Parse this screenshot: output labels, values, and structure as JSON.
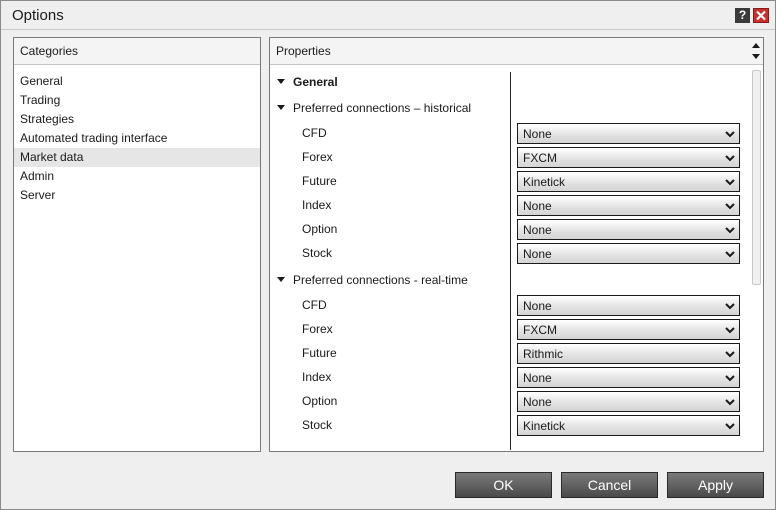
{
  "window": {
    "title": "Options"
  },
  "categories": {
    "header": "Categories",
    "items": [
      "General",
      "Trading",
      "Strategies",
      "Automated trading interface",
      "Market data",
      "Admin",
      "Server"
    ],
    "selected_index": 4
  },
  "properties": {
    "header": "Properties",
    "section_title": "General",
    "historical": {
      "title": "Preferred connections – historical",
      "rows": [
        {
          "label": "CFD",
          "value": "None"
        },
        {
          "label": "Forex",
          "value": "FXCM"
        },
        {
          "label": "Future",
          "value": "Kinetick"
        },
        {
          "label": "Index",
          "value": "None"
        },
        {
          "label": "Option",
          "value": "None"
        },
        {
          "label": "Stock",
          "value": "None"
        }
      ]
    },
    "realtime": {
      "title": "Preferred connections - real-time",
      "rows": [
        {
          "label": "CFD",
          "value": "None"
        },
        {
          "label": "Forex",
          "value": "FXCM"
        },
        {
          "label": "Future",
          "value": "Rithmic"
        },
        {
          "label": "Index",
          "value": "None"
        },
        {
          "label": "Option",
          "value": "None"
        },
        {
          "label": "Stock",
          "value": "Kinetick"
        }
      ]
    }
  },
  "buttons": {
    "ok": "OK",
    "cancel": "Cancel",
    "apply": "Apply"
  },
  "icons": {
    "help": "?",
    "close": "close-icon",
    "expand": "triangle-down-icon",
    "dropdown": "chevron-down-icon"
  }
}
